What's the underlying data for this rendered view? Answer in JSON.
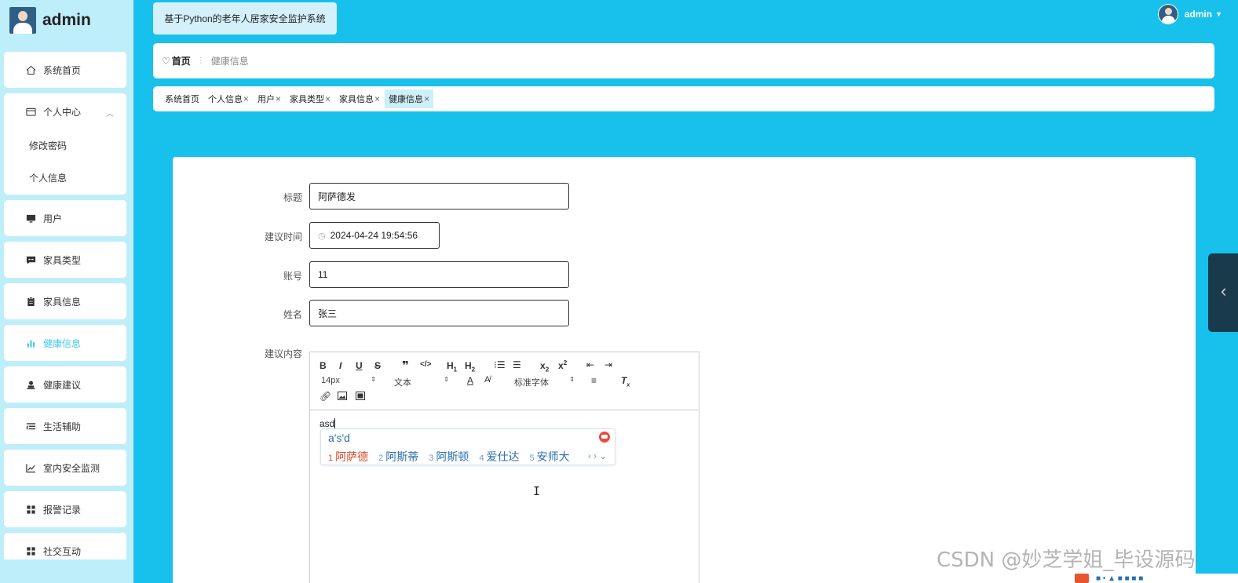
{
  "user": {
    "name": "admin"
  },
  "header": {
    "system_title": "基于Python的老年人居家安全监护系统",
    "user_name": "admin"
  },
  "sidebar": {
    "items": [
      {
        "label": "系统首页",
        "icon": "home-icon"
      },
      {
        "label": "个人中心",
        "icon": "id-card-icon",
        "expanded": true,
        "children": [
          {
            "label": "修改密码"
          },
          {
            "label": "个人信息"
          }
        ]
      },
      {
        "label": "用户",
        "icon": "monitor-icon"
      },
      {
        "label": "家具类型",
        "icon": "chat-icon"
      },
      {
        "label": "家具信息",
        "icon": "clipboard-icon"
      },
      {
        "label": "健康信息",
        "icon": "bar-chart-icon",
        "active": true
      },
      {
        "label": "健康建议",
        "icon": "person-stamp-icon"
      },
      {
        "label": "生活辅助",
        "icon": "list-icon"
      },
      {
        "label": "室内安全监测",
        "icon": "trend-icon"
      },
      {
        "label": "报警记录",
        "icon": "grid-icon"
      },
      {
        "label": "社交互动",
        "icon": "grid-icon"
      }
    ]
  },
  "breadcrumb": {
    "home": "首页",
    "current": "健康信息"
  },
  "tabs": [
    {
      "label": "系统首页",
      "closable": false
    },
    {
      "label": "个人信息",
      "closable": true
    },
    {
      "label": "用户",
      "closable": true
    },
    {
      "label": "家具类型",
      "closable": true
    },
    {
      "label": "家具信息",
      "closable": true
    },
    {
      "label": "健康信息",
      "closable": true,
      "active": true
    }
  ],
  "tab_close_glyph": "×",
  "form": {
    "title_label": "标题",
    "title_value": "阿萨德发",
    "time_label": "建议时间",
    "time_value": "2024-04-24 19:54:56",
    "account_label": "账号",
    "account_value": "11",
    "name_label": "姓名",
    "name_value": "张三",
    "content_label": "建议内容"
  },
  "editor": {
    "font_size": "14px",
    "paragraph": "文本",
    "font_family": "标准字体",
    "text": "asd",
    "ime": {
      "pinyin": "a's'd",
      "candidates": [
        {
          "num": "1",
          "text": "阿萨德"
        },
        {
          "num": "2",
          "text": "阿斯蒂"
        },
        {
          "num": "3",
          "text": "阿斯顿"
        },
        {
          "num": "4",
          "text": "爱仕达"
        },
        {
          "num": "5",
          "text": "安师大"
        }
      ]
    }
  },
  "watermark": "CSDN @妙芝学姐_毕设源码",
  "colors": {
    "accent": "#18c0ec",
    "active_menu": "#41c6ea",
    "sidebar_bg": "#bfeefb"
  }
}
